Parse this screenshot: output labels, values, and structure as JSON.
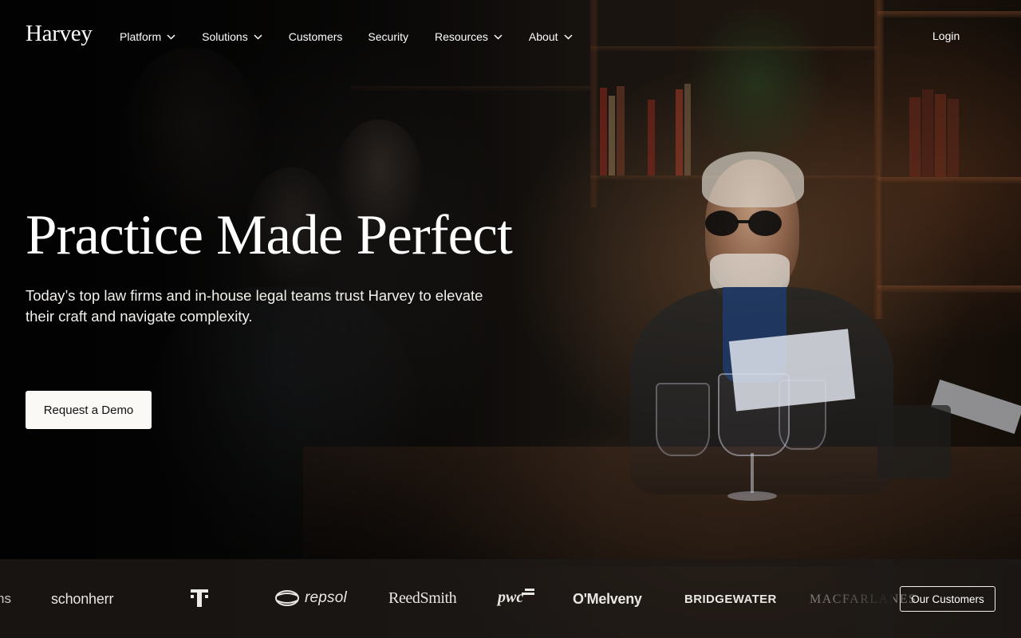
{
  "brand": {
    "logo_text": "Harvey"
  },
  "nav": {
    "items": [
      {
        "label": "Platform",
        "has_dropdown": true
      },
      {
        "label": "Solutions",
        "has_dropdown": true
      },
      {
        "label": "Customers",
        "has_dropdown": false
      },
      {
        "label": "Security",
        "has_dropdown": false
      },
      {
        "label": "Resources",
        "has_dropdown": true
      },
      {
        "label": "About",
        "has_dropdown": true
      }
    ],
    "login_label": "Login"
  },
  "hero": {
    "title": "Practice Made Perfect",
    "subtitle": "Today’s top law firms and in-house legal teams trust Harvey to elevate their craft and navigate complexity.",
    "cta_label": "Request a Demo"
  },
  "customer_logos": {
    "items": [
      {
        "name": "ns",
        "icon": "partial-logo"
      },
      {
        "name": "schonherr",
        "icon": "schonherr-logo"
      },
      {
        "name": "T",
        "icon": "telekom-logo"
      },
      {
        "name": "repsol",
        "icon": "repsol-logo"
      },
      {
        "name": "ReedSmith",
        "icon": "reedsmith-logo"
      },
      {
        "name": "pwc",
        "icon": "pwc-logo"
      },
      {
        "name": "O'Melveny",
        "icon": "omelveny-logo"
      },
      {
        "name": "BRIDGEWATER",
        "icon": "bridgewater-logo"
      },
      {
        "name": "MACFARLANES",
        "icon": "macfarlanes-logo"
      }
    ],
    "button_label": "Our Customers"
  },
  "colors": {
    "text_primary": "#ffffff",
    "cta_background": "#faf9f6",
    "cta_text": "#111111",
    "strip_background": "#1e1a17"
  }
}
